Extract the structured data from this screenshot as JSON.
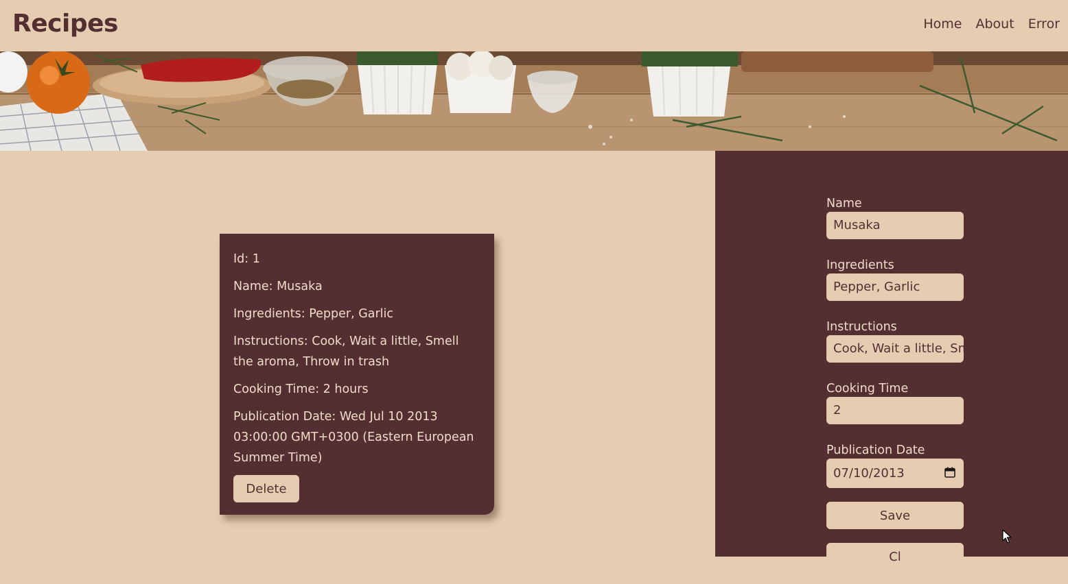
{
  "header": {
    "brand": "Recipes",
    "nav": [
      "Home",
      "About",
      "Error"
    ]
  },
  "colors": {
    "background": "#e6cdb2",
    "accent": "#542f32",
    "text_light": "#f0dcc8"
  },
  "recipe_card": {
    "id": "Id: 1",
    "name": "Name: Musaka",
    "ingredients": "Ingredients: Pepper, Garlic",
    "instructions": "Instructions: Cook, Wait a little, Smell the aroma, Throw in trash",
    "cooking_time": "Cooking Time: 2 hours",
    "publication_date": "Publication Date: Wed Jul 10 2013 03:00:00 GMT+0300 (Eastern European Summer Time)",
    "delete_label": "Delete"
  },
  "form": {
    "name_label": "Name",
    "name_value": "Musaka",
    "ingredients_label": "Ingredients",
    "ingredients_value": "Pepper, Garlic",
    "instructions_label": "Instructions",
    "instructions_value": "Cook, Wait a little, Sm",
    "cooking_time_label": "Cooking Time",
    "cooking_time_value": "2",
    "publication_date_label": "Publication Date",
    "publication_date_value": "07/10/2013",
    "save_label": "Save",
    "clear_label": "Cl"
  },
  "icons": {
    "calendar": "calendar-icon",
    "cursor": "mouse-pointer-icon",
    "banner": "kitchen-banner-image"
  }
}
